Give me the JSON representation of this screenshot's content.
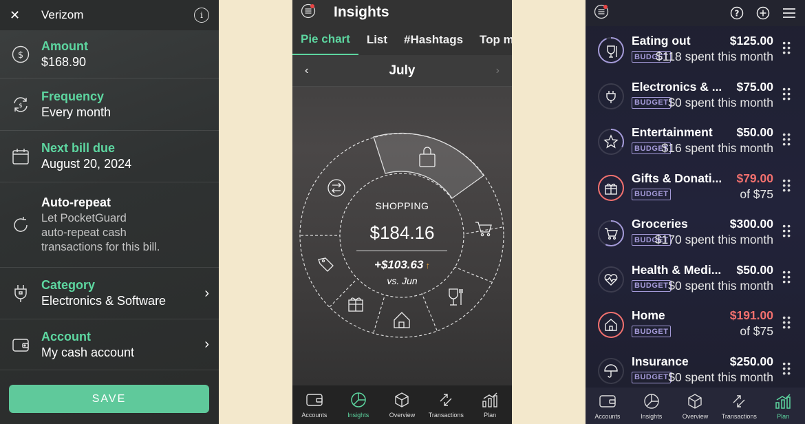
{
  "bill": {
    "title": "Verizom",
    "amount_label": "Amount",
    "amount_value": "$168.90",
    "frequency_label": "Frequency",
    "frequency_value": "Every month",
    "next_due_label": "Next bill due",
    "next_due_value": "August 20, 2024",
    "auto_repeat_label": "Auto-repeat",
    "auto_repeat_desc_1": "Let PocketGuard",
    "auto_repeat_desc_2": "auto-repeat cash",
    "auto_repeat_desc_3": "transactions for this bill.",
    "category_label": "Category",
    "category_value": "Electronics & Software",
    "account_label": "Account",
    "account_value": "My cash account",
    "save_label": "SAVE",
    "accent": "#5dd6a0"
  },
  "insights": {
    "title": "Insights",
    "tabs": [
      "Pie chart",
      "List",
      "#Hashtags",
      "Top m"
    ],
    "month": "July",
    "selected_category": "SHOPPING",
    "selected_amount": "$184.16",
    "change": "+$103.63",
    "compare": "vs. Jun",
    "change_arrow_color": "#e8a33a",
    "nav": [
      "Accounts",
      "Insights",
      "Overview",
      "Transactions",
      "Plan"
    ],
    "active_nav": "Insights"
  },
  "plan": {
    "badge_label": "BUDGET",
    "categories": [
      {
        "name": "Eating out",
        "amount": "$125.00",
        "spent": "$118 spent this month",
        "over": false,
        "progress": 0.94
      },
      {
        "name": "Electronics & ...",
        "amount": "$75.00",
        "spent": "$0 spent this month",
        "over": false,
        "progress": 0
      },
      {
        "name": "Entertainment",
        "amount": "$50.00",
        "spent": "$16 spent this month",
        "over": false,
        "progress": 0.32
      },
      {
        "name": "Gifts & Donati...",
        "amount": "$79.00",
        "spent": "of $75",
        "over": true,
        "progress": 1
      },
      {
        "name": "Groceries",
        "amount": "$300.00",
        "spent": "$170 spent this month",
        "over": false,
        "progress": 0.57
      },
      {
        "name": "Health & Medi...",
        "amount": "$50.00",
        "spent": "$0 spent this month",
        "over": false,
        "progress": 0
      },
      {
        "name": "Home",
        "amount": "$191.00",
        "spent": "of $75",
        "over": true,
        "progress": 1
      },
      {
        "name": "Insurance",
        "amount": "$250.00",
        "spent": "$0 spent this month",
        "over": false,
        "progress": 0
      }
    ],
    "nav": [
      "Accounts",
      "Insights",
      "Overview",
      "Transactions",
      "Plan"
    ],
    "active_nav": "Plan",
    "over_color": "#f2706e",
    "ring_color": "#a49ad8"
  }
}
